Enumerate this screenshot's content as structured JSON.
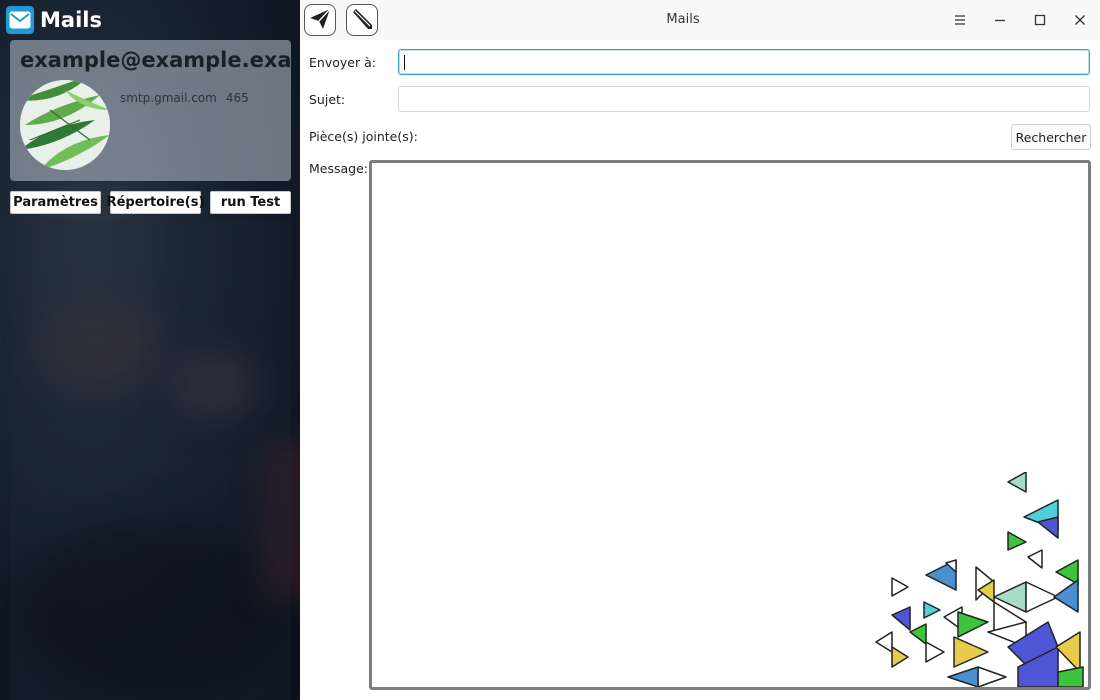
{
  "app": {
    "title": "Mails",
    "icon": "envelope-icon",
    "accent": "#1f9ad6"
  },
  "account": {
    "email": "example@example.exam",
    "smtp_server": "smtp.gmail.com",
    "smtp_port": "465",
    "avatar": "palm-leaves-avatar"
  },
  "sidebar": {
    "buttons": [
      {
        "label": "Paramètres"
      },
      {
        "label": "Répertoire(s)"
      },
      {
        "label": "run Test"
      }
    ]
  },
  "toolbar": {
    "send_icon": "paper-plane-icon",
    "compose_icon": "pencil-icon"
  },
  "window": {
    "title": "Mails",
    "controls": [
      "menu-icon",
      "minimize-icon",
      "maximize-icon",
      "close-icon"
    ]
  },
  "form": {
    "to_label": "Envoyer à:",
    "to_value": "",
    "subject_label": "Sujet:",
    "subject_value": "",
    "attachments_label": "Pièce(s) jointe(s):",
    "search_button": "Rechercher",
    "message_label": "Message:",
    "message_value": "",
    "focus_color": "#3aa3c9"
  }
}
